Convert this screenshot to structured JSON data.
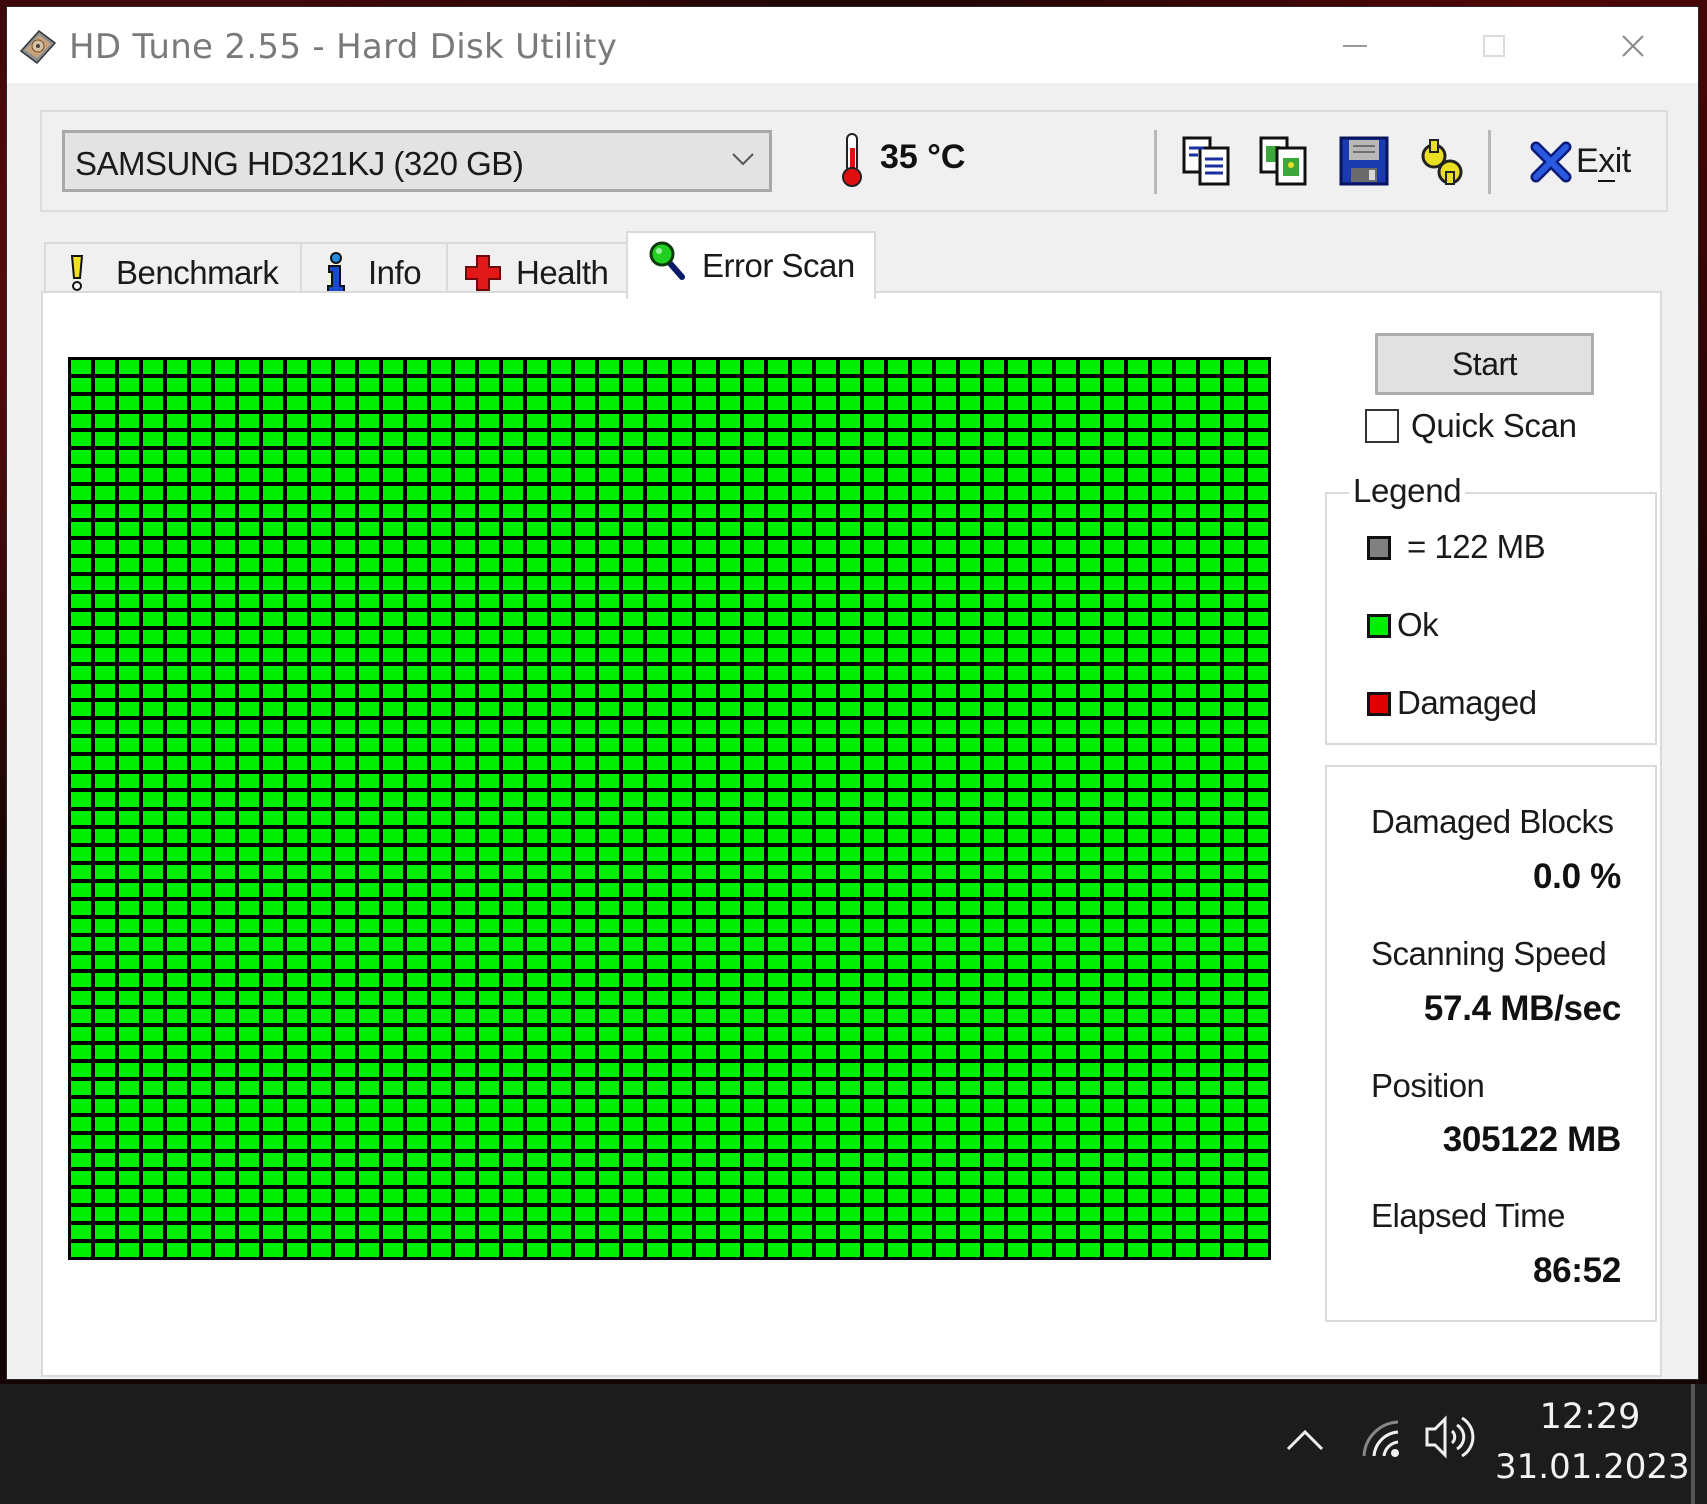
{
  "window": {
    "title": "HD Tune 2.55 - Hard Disk Utility"
  },
  "toolbar": {
    "drive_selected": "SAMSUNG HD321KJ (320 GB)",
    "temperature": "35 °C",
    "buttons": [
      {
        "name": "copy-text",
        "icon": "copy-text-icon"
      },
      {
        "name": "copy-screenshot",
        "icon": "copy-screenshot-icon"
      },
      {
        "name": "save",
        "icon": "floppy-disk-icon"
      },
      {
        "name": "options",
        "icon": "wrench-icon"
      }
    ],
    "exit_label_pre": "E",
    "exit_label_ul": "x",
    "exit_label_post": "it"
  },
  "tabs": [
    {
      "label": "Benchmark",
      "icon": "exclamation-icon",
      "active": false
    },
    {
      "label": "Info",
      "icon": "info-icon",
      "active": false
    },
    {
      "label": "Health",
      "icon": "red-cross-icon",
      "active": false
    },
    {
      "label": "Error Scan",
      "icon": "magnifier-icon",
      "active": true
    }
  ],
  "error_scan": {
    "grid": {
      "columns": 50,
      "rows": 50,
      "damaged_cells": []
    },
    "start_label": "Start",
    "quick_scan_label": "Quick Scan",
    "quick_scan_checked": false,
    "legend": {
      "title": "Legend",
      "block_size": "= 122 MB",
      "ok_label": "Ok",
      "damaged_label": "Damaged",
      "colors": {
        "block": "#808080",
        "ok": "#00ee00",
        "damaged": "#e00000"
      }
    },
    "stats": {
      "damaged_blocks_label": "Damaged Blocks",
      "damaged_blocks_value": "0.0 %",
      "scanning_speed_label": "Scanning Speed",
      "scanning_speed_value": "57.4 MB/sec",
      "position_label": "Position",
      "position_value": "305122 MB",
      "elapsed_time_label": "Elapsed Time",
      "elapsed_time_value": "86:52"
    }
  },
  "taskbar": {
    "time": "12:29",
    "date": "31.01.2023",
    "tray_icons": [
      "chevron-up-icon",
      "wifi-icon",
      "volume-icon"
    ]
  }
}
